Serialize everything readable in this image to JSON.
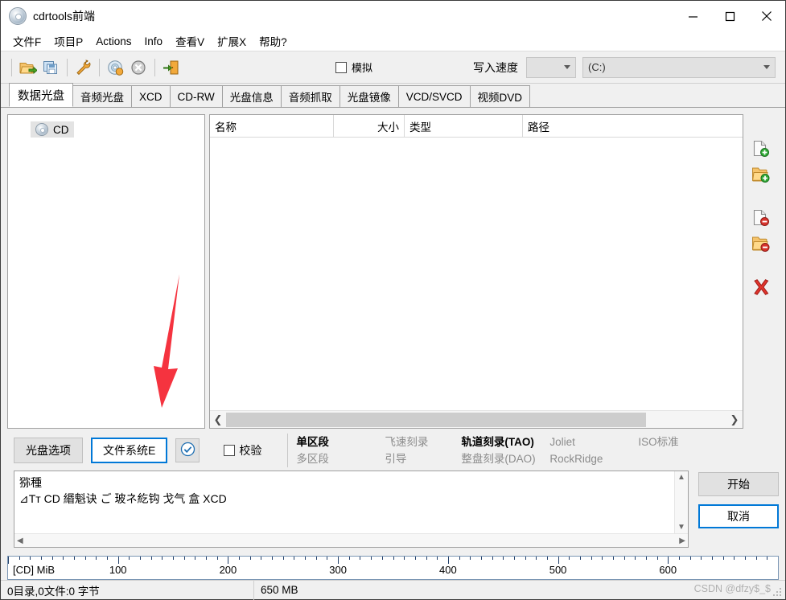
{
  "window": {
    "title": "cdrtools前端",
    "icon": "cd-disc-icon",
    "controls": {
      "minimize": "−",
      "maximize": "□",
      "close": "✕"
    }
  },
  "menubar": {
    "items": [
      {
        "label": "文件F",
        "name": "menu-file"
      },
      {
        "label": "项目P",
        "name": "menu-project"
      },
      {
        "label": "Actions",
        "name": "menu-actions"
      },
      {
        "label": "Info",
        "name": "menu-info"
      },
      {
        "label": "查看V",
        "name": "menu-view"
      },
      {
        "label": "扩展X",
        "name": "menu-extensions"
      },
      {
        "label": "帮助?",
        "name": "menu-help"
      }
    ]
  },
  "toolbar": {
    "buttons": [
      {
        "name": "open-project-icon",
        "title": "open-folder"
      },
      {
        "name": "save-project-icon",
        "title": "save-copy"
      },
      {
        "name": "tools-wrench-icon",
        "title": "wrench"
      },
      {
        "name": "burn-disc-icon",
        "title": "disc-burn"
      },
      {
        "name": "cancel-icon",
        "title": "cancel"
      },
      {
        "name": "exit-door-icon",
        "title": "exit"
      }
    ],
    "simulate_label": "模拟",
    "simulate_checked": false,
    "speed_label": "写入速度",
    "speed_value": "",
    "drive_value": "(C:)"
  },
  "tabs": [
    {
      "label": "数据光盘",
      "active": true
    },
    {
      "label": "音频光盘",
      "active": false
    },
    {
      "label": "XCD",
      "active": false
    },
    {
      "label": "CD-RW",
      "active": false
    },
    {
      "label": "光盘信息",
      "active": false
    },
    {
      "label": "音频抓取",
      "active": false
    },
    {
      "label": "光盘镜像",
      "active": false
    },
    {
      "label": "VCD/SVCD",
      "active": false
    },
    {
      "label": "视频DVD",
      "active": false
    }
  ],
  "tree": {
    "root_label": "CD",
    "root_icon": "cd-disc-icon"
  },
  "filelist": {
    "columns": [
      {
        "label": "名称",
        "name": "column-name"
      },
      {
        "label": "大小",
        "name": "column-size"
      },
      {
        "label": "类型",
        "name": "column-type"
      },
      {
        "label": "路径",
        "name": "column-path"
      }
    ],
    "rows": [],
    "scroll_left_arrow": "❮",
    "scroll_right_arrow": "❯"
  },
  "side_tools": [
    {
      "name": "add-file-icon",
      "title": "add-file"
    },
    {
      "name": "add-folder-icon",
      "title": "add-folder"
    },
    {
      "name": "remove-file-icon",
      "title": "remove-file"
    },
    {
      "name": "remove-folder-icon",
      "title": "remove-folder"
    },
    {
      "name": "delete-all-icon",
      "title": "delete-all"
    }
  ],
  "options_bar": {
    "disc_options_label": "光盘选项",
    "filesystem_label": "文件系统E",
    "confirm_icon": "check-circle-icon",
    "verify_label": "校验",
    "verify_checked": false,
    "grid": {
      "col1": {
        "on": "单区段",
        "off": "多区段"
      },
      "col2": {
        "on": "飞速刻录",
        "off": "引导"
      },
      "col3": {
        "on": "轨道刻录(TAO)",
        "off": "整盘刻录(DAO)"
      },
      "col4": {
        "on": "Joliet",
        "off": "RockRidge"
      },
      "col5": {
        "on": "ISO标准",
        "off": ""
      }
    }
  },
  "log": {
    "line1": "猕種",
    "line2": "⊿Tт  CD 緡魁诀     ご   玻ネ紇钩  戈气  盒  XCD",
    "vscroll_up": "▲",
    "vscroll_down": "▼",
    "hscroll_left": "◀",
    "hscroll_right": "▶"
  },
  "actions": {
    "start_label": "开始",
    "cancel_label": "取消"
  },
  "ruler": {
    "unit_label": "[CD] MiB",
    "labels": [
      "100",
      "200",
      "300",
      "400",
      "500",
      "600"
    ],
    "max": 700
  },
  "statusbar": {
    "left": "0目录,0文件:0 字节",
    "right": "650 MB",
    "watermark": "CSDN @dfzy$_$"
  },
  "annotation": {
    "arrow_color": "#f5333f",
    "points_to": "文件系统E"
  },
  "colors": {
    "accent": "#0078d7",
    "window_bg": "#f0f0f0",
    "panel_bg": "#ffffff",
    "arrow_red": "#f5333f"
  }
}
